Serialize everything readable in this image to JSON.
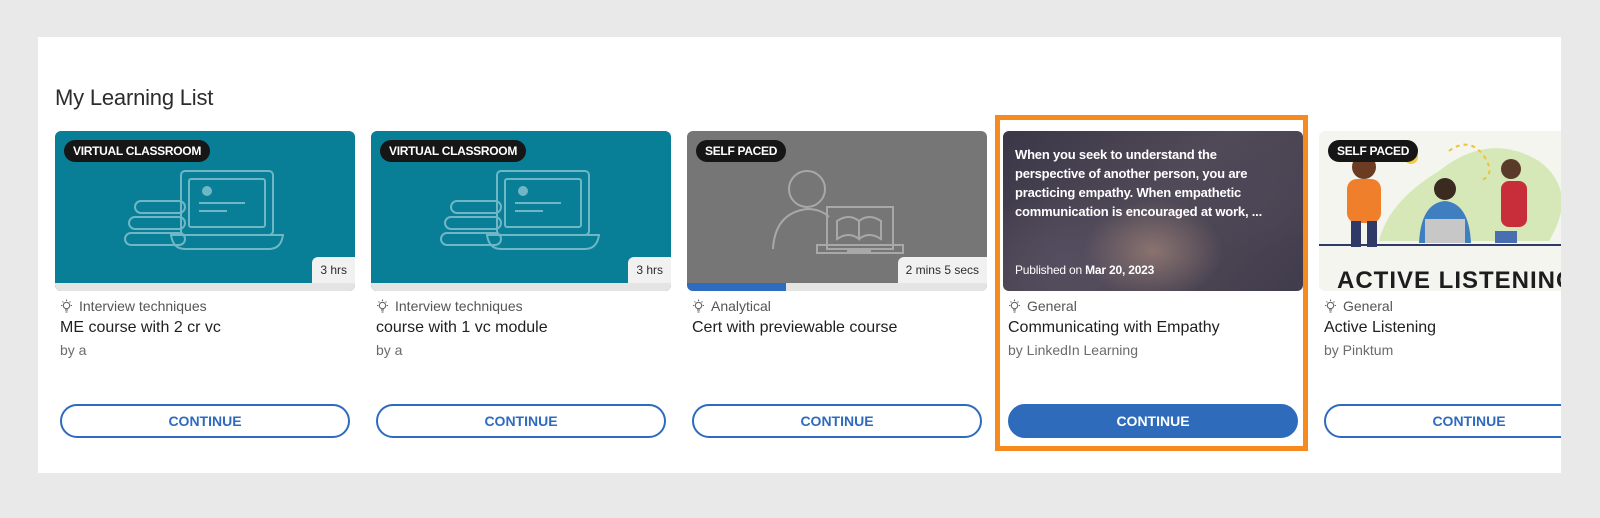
{
  "section": {
    "title": "My Learning List"
  },
  "cards": [
    {
      "badge": "VIRTUAL CLASSROOM",
      "duration": "3 hrs",
      "category": "Interview techniques",
      "title": "ME course with 2 cr vc",
      "author": "by a",
      "button": "CONTINUE",
      "thumb_icon": "laptop-stack-icon"
    },
    {
      "badge": "VIRTUAL CLASSROOM",
      "duration": "3 hrs",
      "category": "Interview techniques",
      "title": "course with 1 vc module",
      "author": "by a",
      "button": "CONTINUE",
      "thumb_icon": "laptop-stack-icon"
    },
    {
      "badge": "SELF PACED",
      "duration": "2 mins 5 secs",
      "category": "Analytical",
      "title": "Cert with previewable course",
      "author": "",
      "button": "CONTINUE",
      "progress": 0.33,
      "thumb_icon": "person-book-icon"
    },
    {
      "description": "When you seek to understand the perspective of another person, you are practicing empathy. When empathetic communication is encouraged at work, ...",
      "published_prefix": "Published on",
      "published_date": "Mar 20, 2023",
      "category": "General",
      "title": "Communicating with Empathy",
      "author": "by LinkedIn Learning",
      "button": "CONTINUE",
      "highlighted": true
    },
    {
      "badge": "SELF PACED",
      "thumb_text": "ACTIVE LISTENING",
      "category": "General",
      "title": "Active Listening",
      "author": "by Pinktum",
      "button": "CONTINUE"
    }
  ],
  "colors": {
    "teal": "#087e97",
    "gray": "#767676",
    "primary_blue": "#2e6bbb",
    "highlight_orange": "#f58a1f"
  }
}
